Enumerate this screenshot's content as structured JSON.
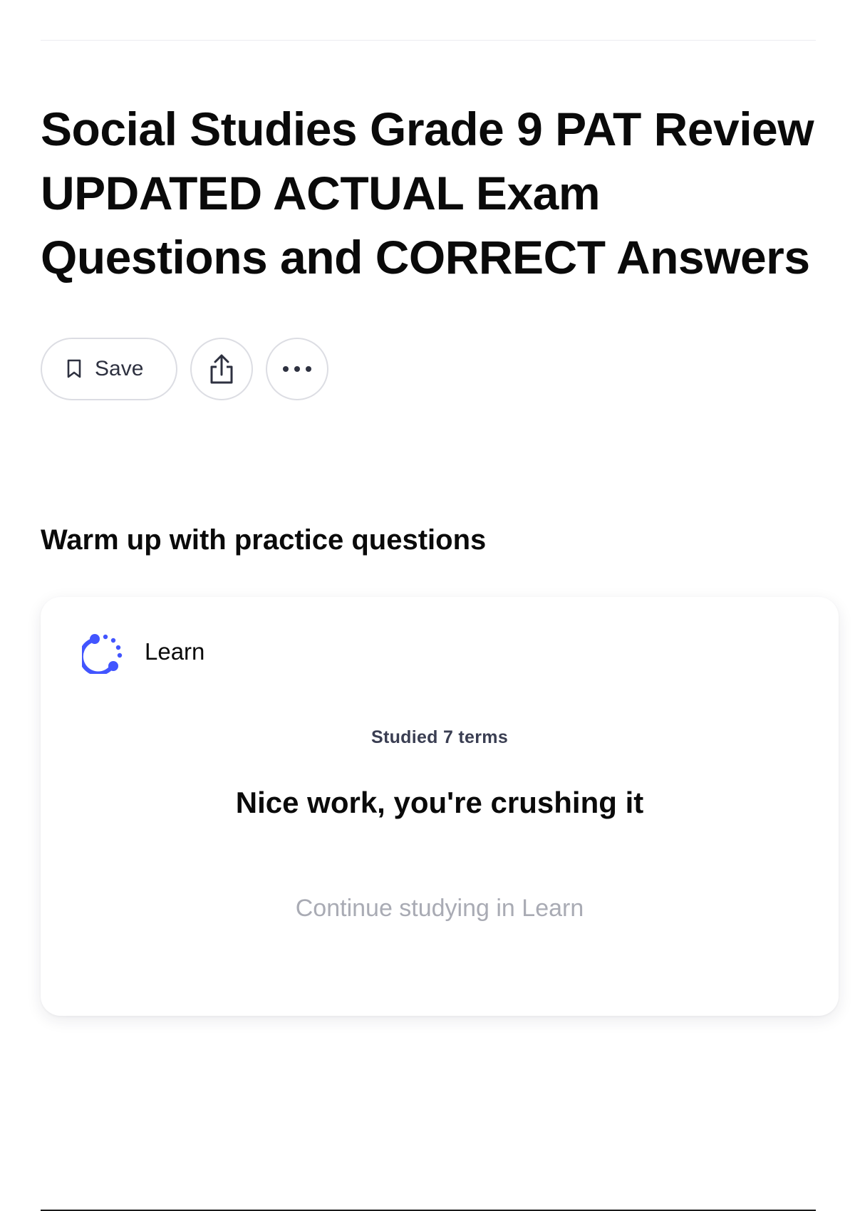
{
  "page": {
    "title": "Social Studies Grade 9 PAT Review UPDATED ACTUAL Exam Questions and CORRECT Answers"
  },
  "actions": {
    "save_label": "Save",
    "save_icon": "bookmark-icon",
    "share_icon": "share-icon",
    "more_icon": "more-options-icon"
  },
  "practice": {
    "heading": "Warm up with practice questions",
    "card": {
      "mode_label": "Learn",
      "mode_icon": "learn-progress-icon",
      "studied_text": "Studied 7 terms",
      "headline": "Nice work, you're crushing it",
      "continue_label": "Continue studying in Learn"
    }
  },
  "colors": {
    "accent": "#4255ff",
    "muted_text": "#a9abb4",
    "border": "#dcdde3"
  }
}
